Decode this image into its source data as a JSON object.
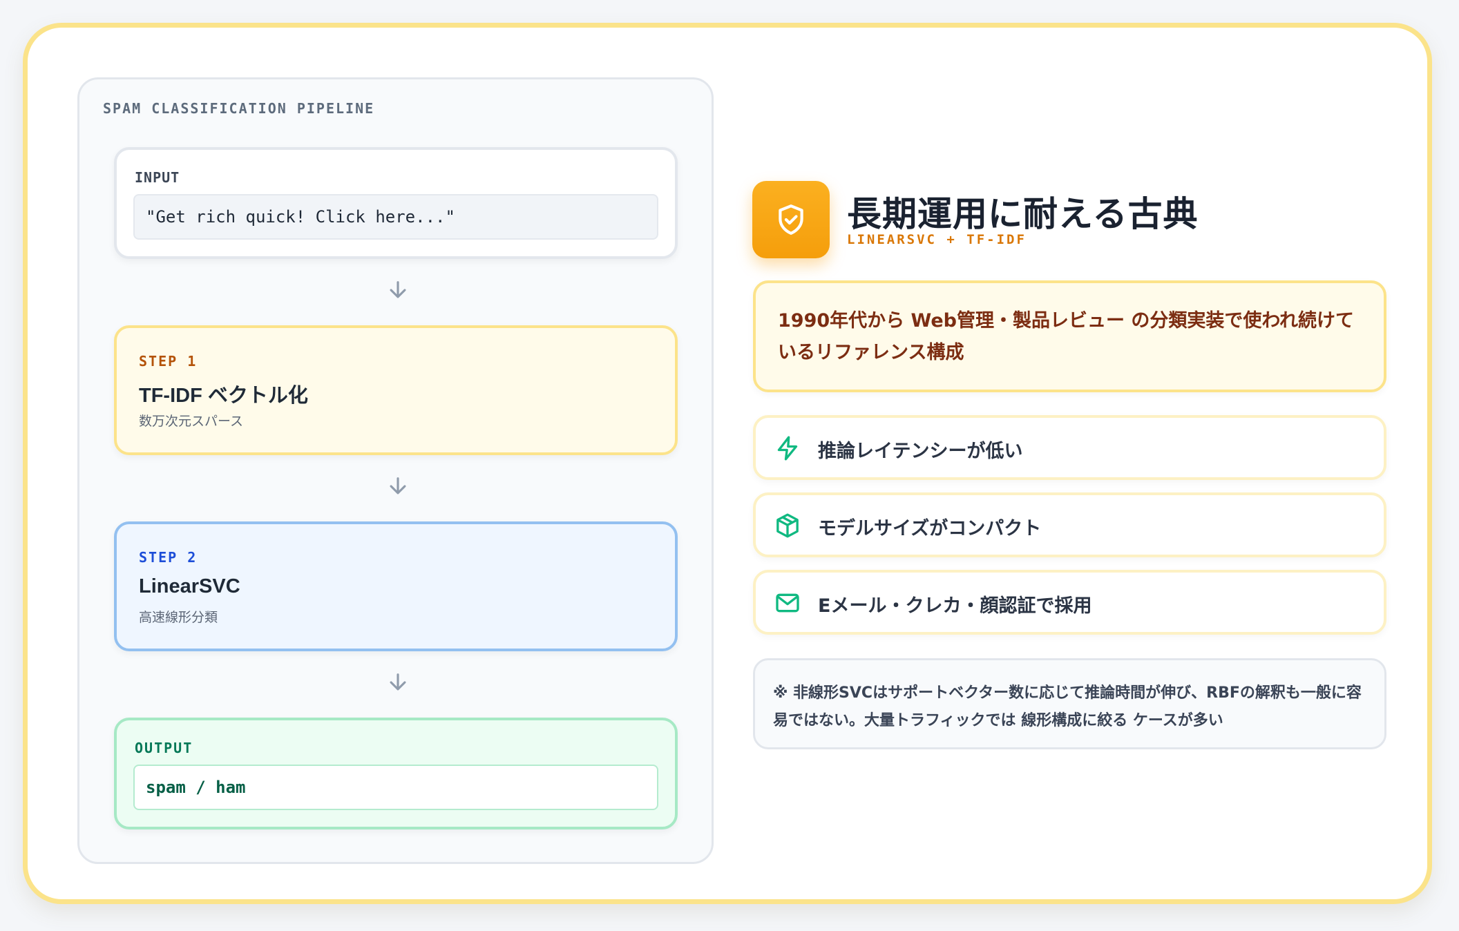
{
  "pipeline": {
    "title": "SPAM CLASSIFICATION PIPELINE",
    "input": {
      "label": "INPUT",
      "value": "\"Get rich quick! Click here...\""
    },
    "steps": [
      {
        "label": "STEP 1",
        "title": "TF-IDF ベクトル化",
        "subtitle": "数万次元スパース"
      },
      {
        "label": "STEP 2",
        "title": "LinearSVC",
        "subtitle": "高速線形分類"
      }
    ],
    "output": {
      "label": "OUTPUT",
      "value": "spam / ham"
    }
  },
  "hero": {
    "icon": "shield-check-icon",
    "title": "長期運用に耐える古典",
    "subtitle": "LINEARSVC + TF-IDF"
  },
  "callout": "1990年代から Web管理・製品レビュー の分類実装で使われ続けているリファレンス構成",
  "features": [
    {
      "icon": "lightning-icon",
      "text": "推論レイテンシーが低い"
    },
    {
      "icon": "cube-icon",
      "text": "モデルサイズがコンパクト"
    },
    {
      "icon": "mail-icon",
      "text": "Eメール・クレカ・顔認証で採用"
    }
  ],
  "note": "※ 非線形SVCはサポートベクター数に応じて推論時間が伸び、RBFの解釈も一般に容易ではない。大量トラフィックでは 線形構成に絞る ケースが多い",
  "colors": {
    "accent": "#f59e0b",
    "step1_border": "#fce38a",
    "step2_border": "#93c0f0",
    "output_border": "#a6e9c5",
    "feature_icon": "#10b981"
  }
}
